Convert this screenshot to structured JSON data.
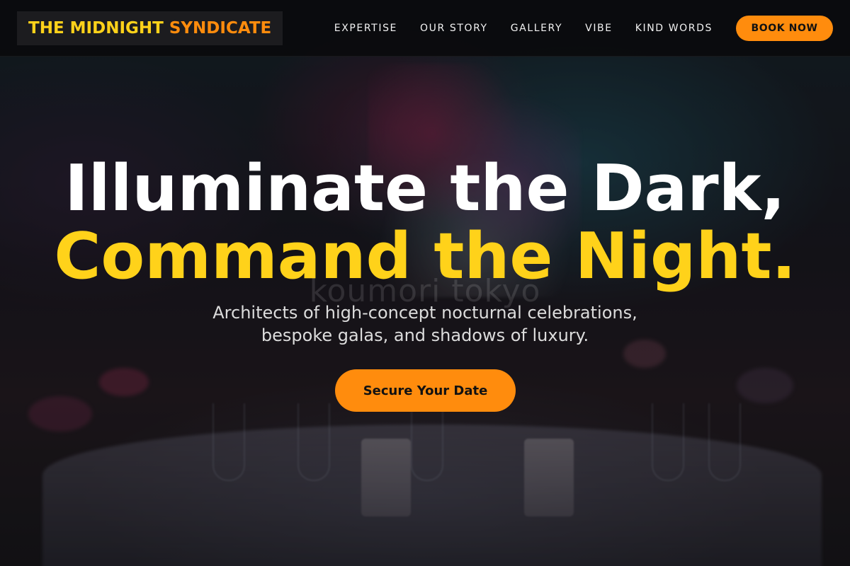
{
  "brand": {
    "name_part1": "THE MIDNIGHT",
    "name_part2": "SYNDICATE"
  },
  "nav": {
    "items": [
      {
        "label": "EXPERTISE"
      },
      {
        "label": "OUR STORY"
      },
      {
        "label": "GALLERY"
      },
      {
        "label": "VIBE"
      },
      {
        "label": "KIND WORDS"
      }
    ],
    "cta_label": "BOOK NOW"
  },
  "hero": {
    "headline_line1": "Illuminate the Dark,",
    "headline_line2": "Command the Night.",
    "watermark": "koumori tokyo",
    "subtext_line1": "Architects of high-concept nocturnal celebrations,",
    "subtext_line2": "bespoke galas, and shadows of luxury.",
    "cta_label": "Secure Your Date"
  },
  "colors": {
    "accent_yellow": "#ffd21a",
    "accent_orange": "#ff8c0d",
    "header_bg": "#0a0a0c"
  }
}
